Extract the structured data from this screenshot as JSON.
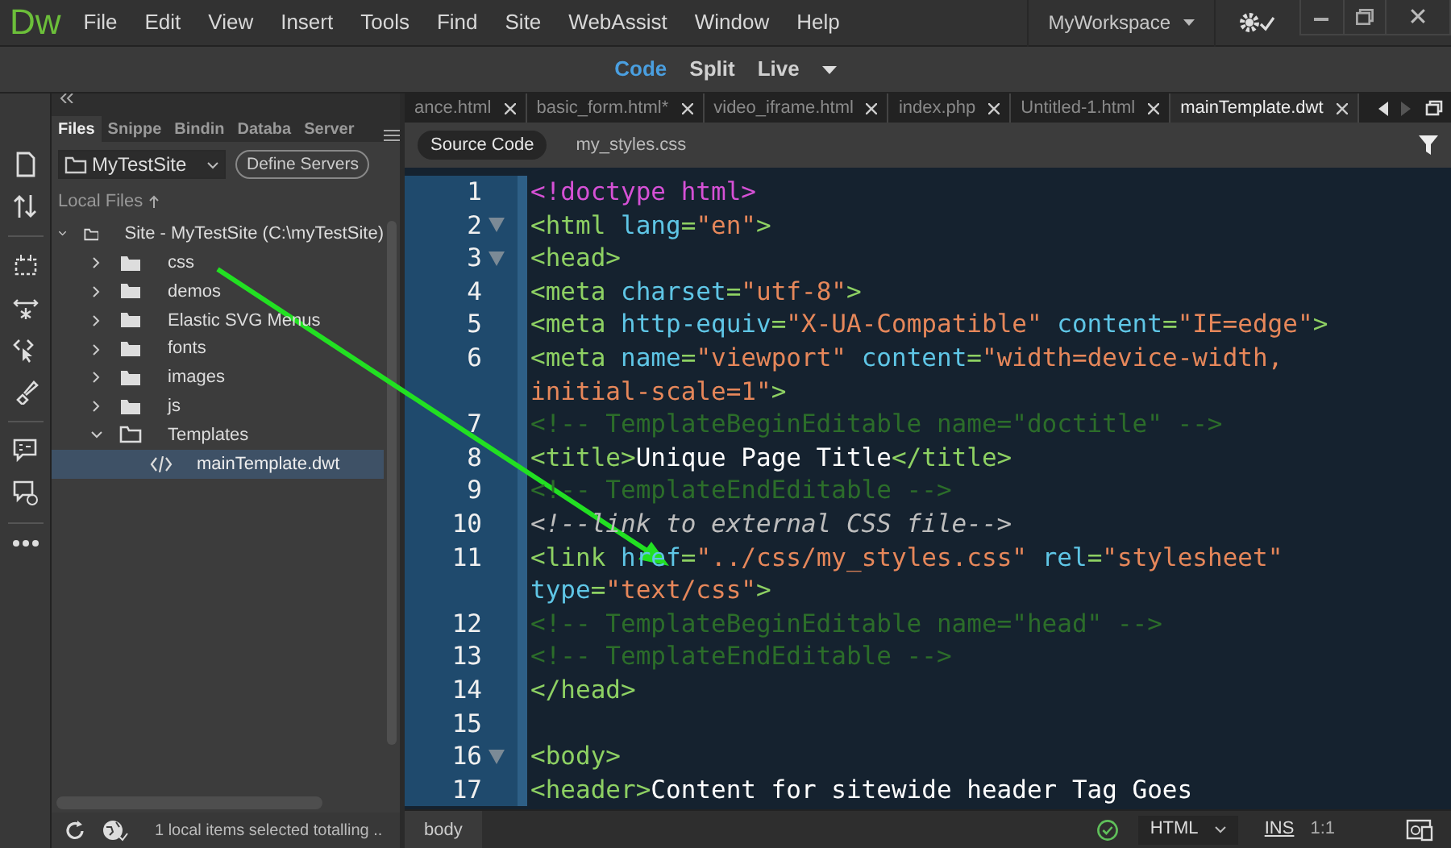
{
  "app": {
    "logo": "Dw",
    "menu": [
      "File",
      "Edit",
      "View",
      "Insert",
      "Tools",
      "Find",
      "Site",
      "WebAssist",
      "Window",
      "Help"
    ],
    "workspace": "MyWorkspace"
  },
  "view_modes": [
    {
      "label": "Code",
      "selected": true
    },
    {
      "label": "Split",
      "selected": false
    },
    {
      "label": "Live",
      "selected": false
    }
  ],
  "doc_tabs": [
    {
      "label": "ance.html",
      "selected": false
    },
    {
      "label": "basic_form.html*",
      "selected": false
    },
    {
      "label": "video_iframe.html",
      "selected": false
    },
    {
      "label": "index.php",
      "selected": false
    },
    {
      "label": "Untitled-1.html",
      "selected": false
    },
    {
      "label": "mainTemplate.dwt",
      "selected": true
    }
  ],
  "files_panel": {
    "tabs": [
      {
        "label": "Files",
        "selected": true
      },
      {
        "label": "Snippe",
        "selected": false
      },
      {
        "label": "Bindin",
        "selected": false
      },
      {
        "label": "Databa",
        "selected": false
      },
      {
        "label": "Server",
        "selected": false
      }
    ],
    "site": "MyTestSite",
    "define_button": "Define Servers",
    "section": "Local Files",
    "tree": [
      {
        "label": "Site - MyTestSite (C:\\myTestSite)",
        "kind": "folder",
        "expanded": true,
        "selected": false,
        "children": [
          {
            "label": "css",
            "kind": "folder",
            "expanded": false,
            "selected": false
          },
          {
            "label": "demos",
            "kind": "folder",
            "expanded": false,
            "selected": false
          },
          {
            "label": "Elastic SVG Menus",
            "kind": "folder",
            "expanded": false,
            "selected": false
          },
          {
            "label": "fonts",
            "kind": "folder",
            "expanded": false,
            "selected": false
          },
          {
            "label": "images",
            "kind": "folder",
            "expanded": false,
            "selected": false
          },
          {
            "label": "js",
            "kind": "folder",
            "expanded": false,
            "selected": false
          },
          {
            "label": "Templates",
            "kind": "folder",
            "expanded": true,
            "selected": false,
            "children": [
              {
                "label": "mainTemplate.dwt",
                "kind": "file",
                "selected": true
              }
            ]
          }
        ]
      }
    ],
    "status": "1 local items selected totalling .."
  },
  "related_files": [
    {
      "label": "Source Code",
      "selected": true
    },
    {
      "label": "my_styles.css",
      "selected": false
    }
  ],
  "code": [
    {
      "number": "1",
      "fold": false,
      "tokens": [
        {
          "kind": "doctype",
          "text": "<!doctype html>"
        }
      ]
    },
    {
      "number": "2",
      "fold": true,
      "tokens": [
        {
          "kind": "tag",
          "text": "<html"
        },
        {
          "kind": "attr",
          "text": " lang"
        },
        {
          "kind": "tag",
          "text": "="
        },
        {
          "kind": "string",
          "text": "\"en\""
        },
        {
          "kind": "tag",
          "text": ">"
        }
      ]
    },
    {
      "number": "3",
      "fold": true,
      "tokens": [
        {
          "kind": "tag",
          "text": "<head>"
        }
      ]
    },
    {
      "number": "4",
      "fold": false,
      "tokens": [
        {
          "kind": "tag",
          "text": "<meta"
        },
        {
          "kind": "attr",
          "text": " charset"
        },
        {
          "kind": "tag",
          "text": "="
        },
        {
          "kind": "string",
          "text": "\"utf-8\""
        },
        {
          "kind": "tag",
          "text": ">"
        }
      ]
    },
    {
      "number": "5",
      "fold": false,
      "tokens": [
        {
          "kind": "tag",
          "text": "<meta"
        },
        {
          "kind": "attr",
          "text": " http-equiv"
        },
        {
          "kind": "tag",
          "text": "="
        },
        {
          "kind": "string",
          "text": "\"X-UA-Compatible\""
        },
        {
          "kind": "attr",
          "text": " content"
        },
        {
          "kind": "tag",
          "text": "="
        },
        {
          "kind": "string",
          "text": "\"IE=edge\""
        },
        {
          "kind": "tag",
          "text": ">"
        }
      ]
    },
    {
      "number": "6",
      "fold": false,
      "tokens": [
        {
          "kind": "tag",
          "text": "<meta"
        },
        {
          "kind": "attr",
          "text": " name"
        },
        {
          "kind": "tag",
          "text": "="
        },
        {
          "kind": "string",
          "text": "\"viewport\""
        },
        {
          "kind": "attr",
          "text": " content"
        },
        {
          "kind": "tag",
          "text": "="
        },
        {
          "kind": "string",
          "text": "\"width=device-width,"
        }
      ]
    },
    {
      "fold": false,
      "tokens": [
        {
          "kind": "string",
          "text": "initial-scale=1\""
        },
        {
          "kind": "tag",
          "text": ">"
        }
      ]
    },
    {
      "number": "7",
      "fold": false,
      "tokens": [
        {
          "kind": "comment",
          "text": "<!-- TemplateBeginEditable name=\"doctitle\" -->"
        }
      ]
    },
    {
      "number": "8",
      "fold": false,
      "tokens": [
        {
          "kind": "tag",
          "text": "<title>"
        },
        {
          "kind": "text",
          "text": "Unique Page Title"
        },
        {
          "kind": "tag",
          "text": "</title>"
        }
      ]
    },
    {
      "number": "9",
      "fold": false,
      "tokens": [
        {
          "kind": "comment",
          "text": "<!-- TemplateEndEditable -->"
        }
      ]
    },
    {
      "number": "10",
      "fold": false,
      "tokens": [
        {
          "kind": "note",
          "text": "<!--link to external CSS file-->"
        }
      ]
    },
    {
      "number": "11",
      "fold": false,
      "tokens": [
        {
          "kind": "tag",
          "text": "<link"
        },
        {
          "kind": "attr",
          "text": " href"
        },
        {
          "kind": "tag",
          "text": "="
        },
        {
          "kind": "string",
          "text": "\"../css/my_styles.css\""
        },
        {
          "kind": "attr",
          "text": " rel"
        },
        {
          "kind": "tag",
          "text": "="
        },
        {
          "kind": "string",
          "text": "\"stylesheet\""
        }
      ]
    },
    {
      "fold": false,
      "tokens": [
        {
          "kind": "attr",
          "text": "type"
        },
        {
          "kind": "tag",
          "text": "="
        },
        {
          "kind": "string",
          "text": "\"text/css\""
        },
        {
          "kind": "tag",
          "text": ">"
        }
      ]
    },
    {
      "number": "12",
      "fold": false,
      "tokens": [
        {
          "kind": "comment",
          "text": "<!-- TemplateBeginEditable name=\"head\" -->"
        }
      ]
    },
    {
      "number": "13",
      "fold": false,
      "tokens": [
        {
          "kind": "comment",
          "text": "<!-- TemplateEndEditable -->"
        }
      ]
    },
    {
      "number": "14",
      "fold": false,
      "tokens": [
        {
          "kind": "tag",
          "text": "</head>"
        }
      ]
    },
    {
      "number": "15",
      "fold": false
    },
    {
      "number": "16",
      "fold": true,
      "tokens": [
        {
          "kind": "tag",
          "text": "<body>"
        }
      ]
    },
    {
      "number": "17",
      "fold": false,
      "tokens": [
        {
          "kind": "tag",
          "text": "<header>"
        },
        {
          "kind": "text",
          "text": "Content for sitewide header Tag Goes"
        }
      ]
    }
  ],
  "status_bar": {
    "breadcrumb": "body",
    "language": "HTML",
    "mode": "INS",
    "position": "1:1"
  }
}
